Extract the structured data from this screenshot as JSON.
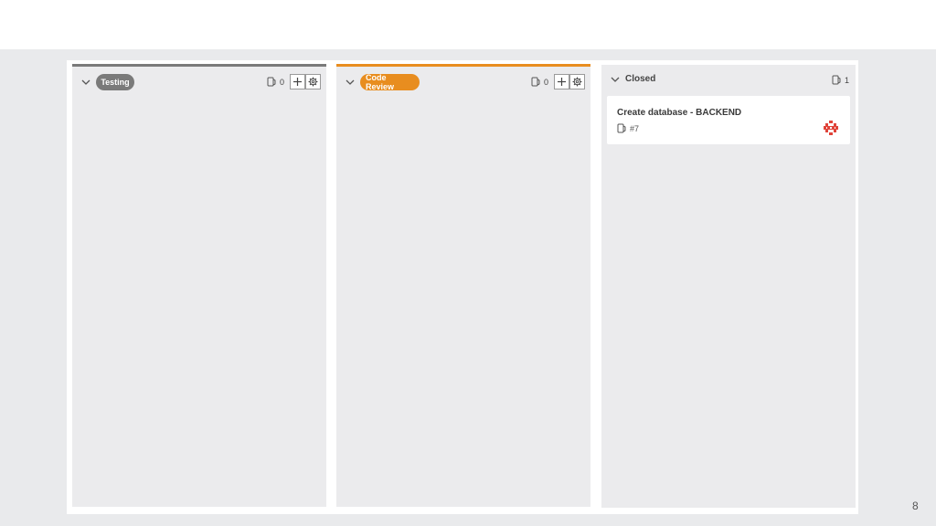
{
  "columns": [
    {
      "id": "testing",
      "label": "Testing",
      "count": "0",
      "accent_color": "#7a7a7a"
    },
    {
      "id": "code-review",
      "label": "Code Review",
      "count": "0",
      "accent_color": "#e88d1f"
    },
    {
      "id": "closed",
      "label": "Closed",
      "count": "1",
      "accent_color": "#ebebed"
    }
  ],
  "closed_cards": [
    {
      "title": "Create database - BACKEND",
      "issue_number": "#7",
      "avatar_color": "#e0443a"
    }
  ],
  "icons": {
    "collapse": "chevron-down-icon",
    "count": "issue-icon",
    "add": "plus-icon",
    "settings": "gear-icon",
    "avatar": "identicon-avatar"
  },
  "page_number": "8"
}
